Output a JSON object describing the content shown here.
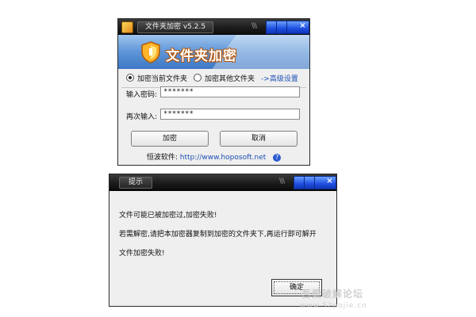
{
  "main_window": {
    "title": "文件夹加密 v5.2.5",
    "banner_title": "文件夹加密",
    "radio_options": [
      {
        "label": "加密当前文件夹",
        "selected": true
      },
      {
        "label": "加密其他文件夹",
        "selected": false
      }
    ],
    "advanced_link": "->高级设置",
    "password_label": "输入密码:",
    "password_value": "*******",
    "confirm_label": "再次输入:",
    "confirm_value": "*******",
    "encrypt_button": "加密",
    "cancel_button": "取消",
    "footer_brand": "恒波软件:",
    "footer_url": "http://www.hoposoft.net",
    "help_icon": "question-icon",
    "close_icon": "×"
  },
  "dialog": {
    "title": "提示",
    "messages": [
      "文件可能已被加密过,加密失败!",
      "若需解密,请把本加密器复制到加密的文件夹下,再运行即可解开",
      "文件加密失败!"
    ],
    "ok_button": "确定",
    "close_icon": "×"
  },
  "watermark": {
    "line1": "吾爱破解论坛",
    "line2": "www.52pojie.cn"
  },
  "colors": {
    "banner_blue": "#5d95d8",
    "title_bar": "#1c1c1c",
    "link_blue": "#1d4fb5",
    "accent_orange": "#e08a1a"
  }
}
